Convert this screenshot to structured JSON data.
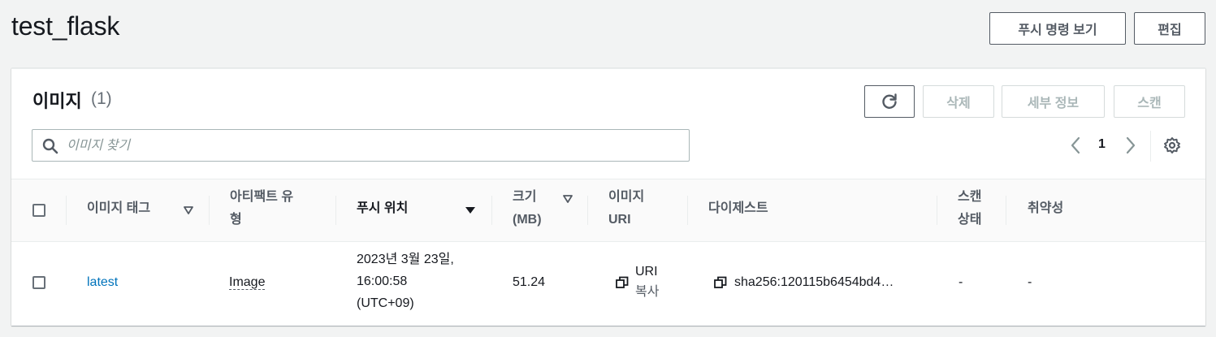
{
  "header": {
    "title": "test_flask",
    "push_button": "푸시 명령 보기",
    "edit_button": "편집"
  },
  "images_panel": {
    "title": "이미지",
    "count": "(1)",
    "delete_button": "삭제",
    "details_button": "세부 정보",
    "scan_button": "스캔",
    "search_placeholder": "이미지 찾기",
    "page_number": "1"
  },
  "table": {
    "columns": {
      "tag": "이미지 태그",
      "artifact_type_1": "아티팩트 유",
      "artifact_type_2": "형",
      "pushed_at": "푸시 위치",
      "size_1": "크기",
      "size_2": "(MB)",
      "uri_1": "이미지",
      "uri_2": "URI",
      "digest": "다이제스트",
      "scan_status_1": "스캔",
      "scan_status_2": "상태",
      "vulnerabilities": "취약성"
    },
    "rows": [
      {
        "tag": "latest",
        "artifact_type": "Image",
        "pushed_at_1": "2023년 3월 23일,",
        "pushed_at_2": "16:00:58",
        "pushed_at_3": "(UTC+09)",
        "size": "51.24",
        "uri_copy_1": "URI",
        "uri_copy_2": "복사",
        "digest": "sha256:120115b6454bd4…",
        "scan_status": "-",
        "vulnerabilities": "-"
      }
    ]
  },
  "colors": {
    "link": "#0073bb",
    "background": "#f2f3f3",
    "border": "#545b64"
  }
}
